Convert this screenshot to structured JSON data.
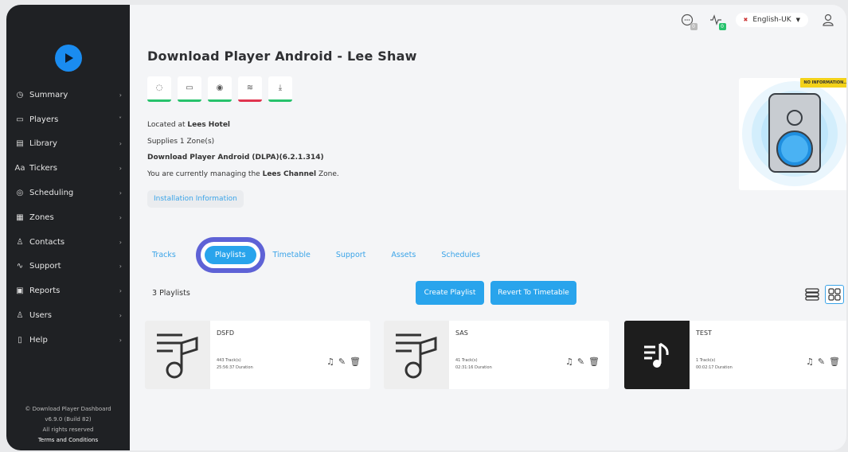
{
  "sidebar": {
    "items": [
      {
        "label": "Summary",
        "icon": "clock-icon",
        "glyph": "◷"
      },
      {
        "label": "Players",
        "icon": "player-icon",
        "glyph": "▭"
      },
      {
        "label": "Library",
        "icon": "library-icon",
        "glyph": "▤"
      },
      {
        "label": "Tickers",
        "icon": "tickers-icon",
        "glyph": "Aa"
      },
      {
        "label": "Scheduling",
        "icon": "scheduling-icon",
        "glyph": "◎"
      },
      {
        "label": "Zones",
        "icon": "zones-icon",
        "glyph": "▦"
      },
      {
        "label": "Contacts",
        "icon": "contacts-icon",
        "glyph": "♙"
      },
      {
        "label": "Support",
        "icon": "pulse-icon",
        "glyph": "∿"
      },
      {
        "label": "Reports",
        "icon": "reports-icon",
        "glyph": "▣"
      },
      {
        "label": "Users",
        "icon": "user-icon",
        "glyph": "♙"
      },
      {
        "label": "Help",
        "icon": "help-icon",
        "glyph": "▯"
      }
    ],
    "footer": {
      "line1": "© Download Player Dashboard",
      "line2": "v6.9.0 (Build 82)",
      "line3": "All rights reserved",
      "terms": "Terms and Conditions"
    }
  },
  "topbar": {
    "messages_badge": "0",
    "activity_badge": "0",
    "language": "English-UK"
  },
  "header": {
    "title": "Download Player Android - Lee Shaw",
    "located_prefix": "Located at ",
    "located_value": "Lees Hotel",
    "supplies": "Supplies 1 Zone(s)",
    "device": "Download Player Android (DLPA)(6.2.1.314)",
    "managing_prefix": "You are currently managing the ",
    "managing_value": "Lees Channel",
    "managing_suffix": " Zone.",
    "install_button": "Installation Information",
    "no_info_badge": "NO INFORMATION..."
  },
  "tabs": [
    "Tracks",
    "Playlists",
    "Timetable",
    "Support",
    "Assets",
    "Schedules"
  ],
  "active_tab": "Playlists",
  "playlists": {
    "count_label": "3 Playlists",
    "create_button": "Create Playlist",
    "revert_button": "Revert To Timetable",
    "items": [
      {
        "name": "DSFD",
        "tracks": "443 Track(s)",
        "duration": "25:56:37 Duration"
      },
      {
        "name": "SAS",
        "tracks": "41 Track(s)",
        "duration": "02:31:16 Duration"
      },
      {
        "name": "TEST",
        "tracks": "1 Track(s)",
        "duration": "00:02:17 Duration"
      }
    ]
  },
  "colors": {
    "accent": "#29a4ec",
    "sidebar_bg": "#1f2124",
    "status_ok": "#27c26c",
    "status_error": "#e0344f",
    "highlight_ring": "#5e62d6"
  }
}
